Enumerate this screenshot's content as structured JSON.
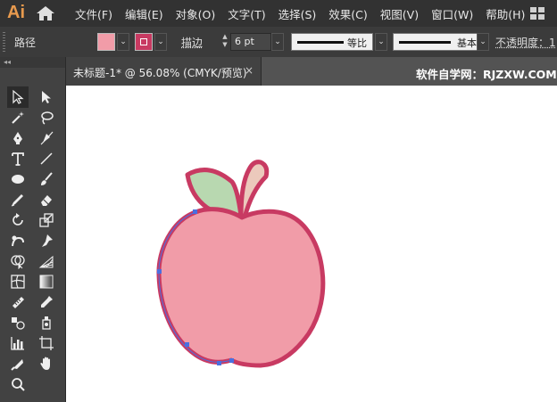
{
  "app": {
    "logo_text": "Ai"
  },
  "menu": [
    "文件(F)",
    "编辑(E)",
    "对象(O)",
    "文字(T)",
    "选择(S)",
    "效果(C)",
    "视图(V)",
    "窗口(W)",
    "帮助(H)"
  ],
  "control_bar": {
    "selection_label": "路径",
    "fill_color": "#f19ca8",
    "stroke_color": "#c83a62",
    "stroke_label": "描边",
    "stroke_weight": "6 pt",
    "variable_width_label": "等比",
    "brush_label": "基本",
    "opacity_label": "不透明度：1"
  },
  "document": {
    "tab_title": "未标题-1* @ 56.08% (CMYK/预览)",
    "close_glyph": "×",
    "watermark": "软件自学网：RJZXW.COM"
  },
  "toolbox_header": "◂◂",
  "artwork": {
    "apple_fill": "#f19ca8",
    "apple_stroke": "#c83a62",
    "leaf_fill": "#b8d8b0",
    "stem_fill": "#ecc9bc",
    "anchor_color": "#4a6fe0"
  }
}
